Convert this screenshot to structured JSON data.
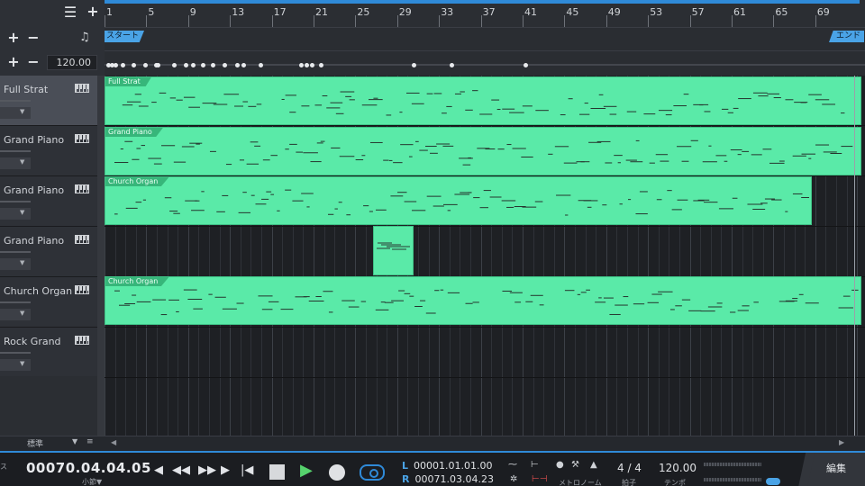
{
  "header": {
    "add_track_label": "+",
    "remove_track_label": "−",
    "tempo_value": "120.00"
  },
  "ruler": {
    "bars": [
      "1",
      "5",
      "9",
      "13",
      "17",
      "21",
      "25",
      "29",
      "33",
      "37",
      "41",
      "45",
      "49",
      "53",
      "57",
      "61",
      "65",
      "69"
    ]
  },
  "markers": {
    "start": "スタート",
    "end": "エンド"
  },
  "tracks": [
    {
      "name": "Full Strat",
      "selected": true
    },
    {
      "name": "Grand Piano",
      "selected": false
    },
    {
      "name": "Grand Piano",
      "selected": false
    },
    {
      "name": "Grand Piano",
      "selected": false
    },
    {
      "name": "Church Organ",
      "selected": false
    },
    {
      "name": "Rock Grand",
      "selected": false
    }
  ],
  "clips": [
    {
      "label": "Full Strat"
    },
    {
      "label": "Grand Piano"
    },
    {
      "label": "Church Organ"
    },
    {
      "label": ""
    },
    {
      "label": "Church Organ"
    }
  ],
  "scroll": {
    "mode": "標準"
  },
  "transport": {
    "left_fragment": "ス",
    "position": "00070.04.04.05",
    "position_unit": "小節▼",
    "loop_left": "00001.01.01.00",
    "loop_right": "00071.03.04.23",
    "l_label": "L",
    "r_label": "R",
    "metronome_label": "メトロノーム",
    "time_sig": "4 / 4",
    "time_sig_label": "拍子",
    "tempo": "120.00",
    "tempo_label": "テンポ",
    "edit_label": "編集"
  },
  "colors": {
    "accent": "#2f8ad8",
    "clip": "#5aeaa8",
    "play": "#56d36d"
  }
}
